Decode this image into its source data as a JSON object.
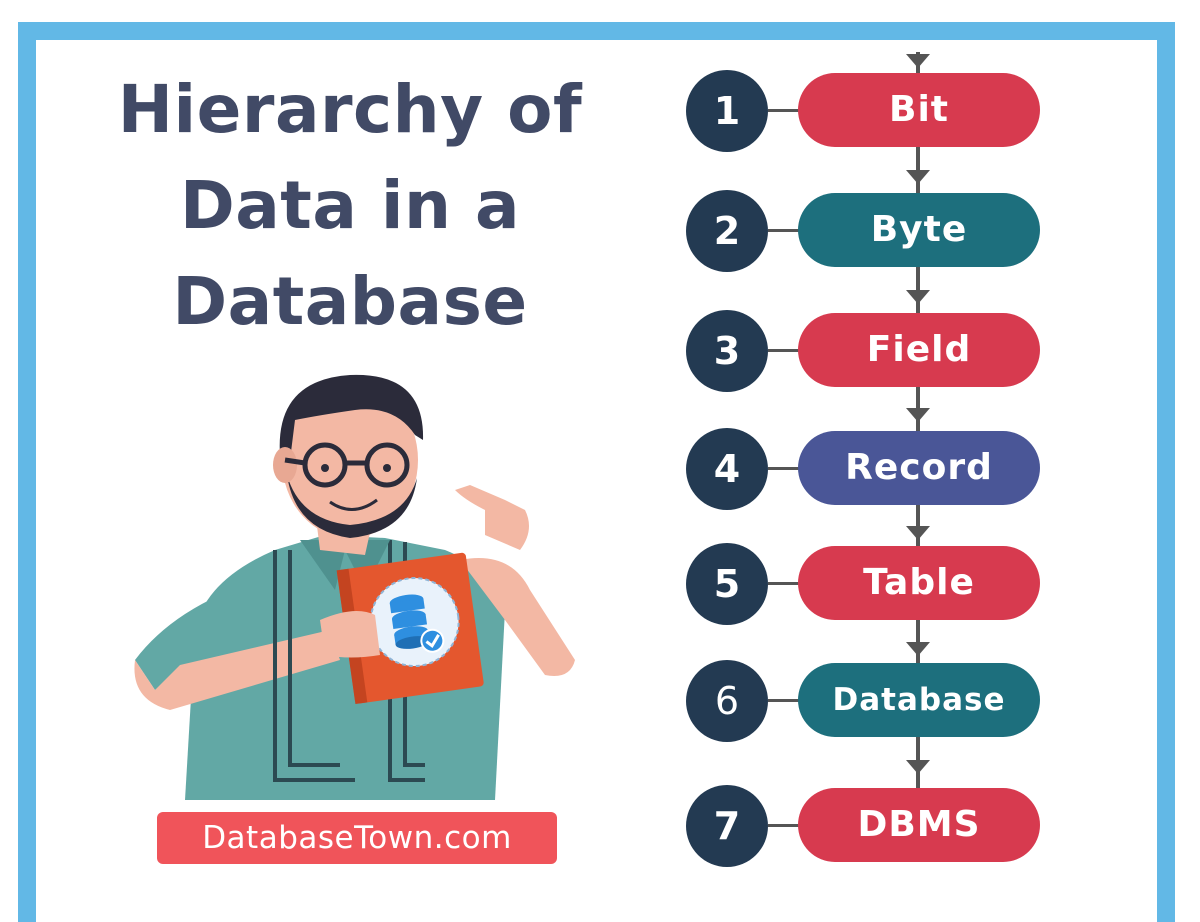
{
  "title": {
    "line1": "Hierarchy of",
    "line2": "Data in a",
    "line3": "Database"
  },
  "brand": {
    "text": "DatabaseTown.com"
  },
  "colors": {
    "frame": "#62b8e6",
    "title": "#414a66",
    "number_circle": "#233a52",
    "red": "#d73a4f",
    "teal": "#1d6f7d",
    "indigo": "#4a5697",
    "brand_bg": "#f0545a"
  },
  "steps": [
    {
      "number": "1",
      "label": "Bit",
      "color": "#d73a4f"
    },
    {
      "number": "2",
      "label": "Byte",
      "color": "#1d6f7d"
    },
    {
      "number": "3",
      "label": "Field",
      "color": "#d73a4f"
    },
    {
      "number": "4",
      "label": "Record",
      "color": "#4a5697"
    },
    {
      "number": "5",
      "label": "Table",
      "color": "#d73a4f"
    },
    {
      "number": "6",
      "label": "Database",
      "color": "#1d6f7d"
    },
    {
      "number": "7",
      "label": "DBMS",
      "color": "#d73a4f"
    }
  ],
  "illustration": {
    "subject": "man with glasses holding a book",
    "book_icon": "database-check-icon"
  }
}
